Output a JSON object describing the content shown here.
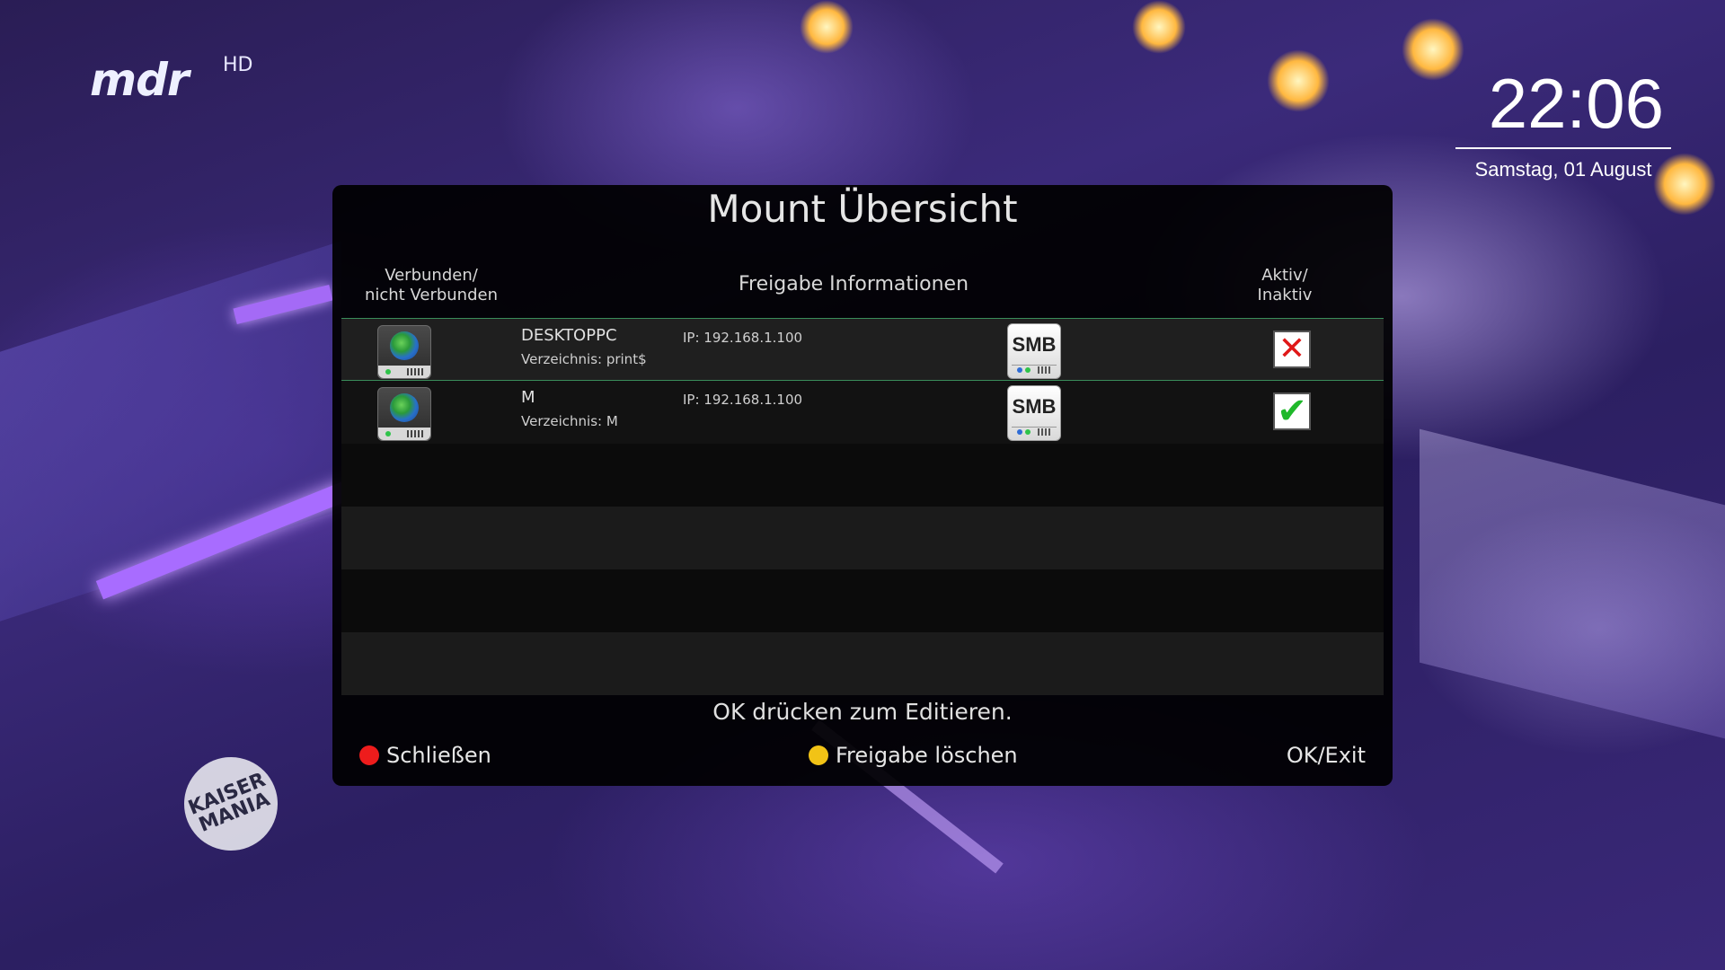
{
  "channel": {
    "logo": "mdr",
    "hd": "HD"
  },
  "clock": {
    "time": "22:06",
    "date": "Samstag, 01 August"
  },
  "watermark": "KAISER MANIA",
  "panel": {
    "title": "Mount Übersicht",
    "headers": {
      "connected_line1": "Verbunden/",
      "connected_line2": "nicht Verbunden",
      "info": "Freigabe Informationen",
      "active_line1": "Aktiv/",
      "active_line2": "Inaktiv"
    },
    "mounts": [
      {
        "name": "DESKTOPPC",
        "directory": "Verzeichnis: print$",
        "ip": "IP: 192.168.1.100",
        "type": "SMB",
        "active": false,
        "status_icon": "x-mark-icon"
      },
      {
        "name": "M",
        "directory": "Verzeichnis: M",
        "ip": "IP: 192.168.1.100",
        "type": "SMB",
        "active": true,
        "status_icon": "check-mark-icon"
      }
    ],
    "hint": "OK drücken zum Editieren.",
    "footer": {
      "close": "Schließen",
      "delete": "Freigabe löschen",
      "ok_exit": "OK/Exit",
      "red_color": "#ee1c1c",
      "yellow_color": "#f2c316"
    }
  }
}
